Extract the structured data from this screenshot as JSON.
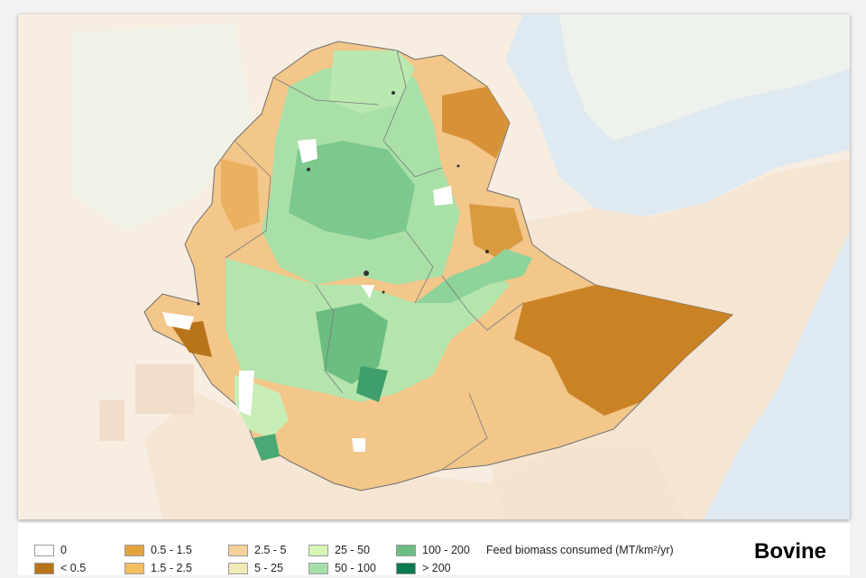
{
  "map": {
    "region": "Ethiopia",
    "colors": {
      "sea": "#dfe9f1",
      "land_beige": "#f5e5d3",
      "land_pale": "#f7ede1",
      "outline": "#6e6e6e"
    }
  },
  "legend": {
    "title": "Feed biomass consumed (MT/km²/yr)",
    "classes": [
      {
        "label": "0",
        "color": "#ffffff"
      },
      {
        "label": "< 0.5",
        "color": "#b8741a"
      },
      {
        "label": "0.5 - 1.5",
        "color": "#e4a43c"
      },
      {
        "label": "1.5 - 2.5",
        "color": "#f6bd5f"
      },
      {
        "label": "2.5 - 5",
        "color": "#f6d19a"
      },
      {
        "label": "5 - 25",
        "color": "#f2eab8"
      },
      {
        "label": "25 - 50",
        "color": "#d5f5b5"
      },
      {
        "label": "50 - 100",
        "color": "#a6dfa7"
      },
      {
        "label": "100 - 200",
        "color": "#6cbd82"
      },
      {
        "label": "> 200",
        "color": "#0b7a4f"
      }
    ]
  },
  "species": "Bovine"
}
